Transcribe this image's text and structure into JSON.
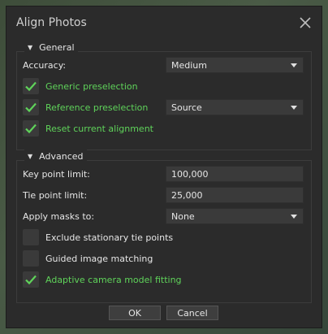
{
  "dialog": {
    "title": "Align Photos"
  },
  "general": {
    "header": "General",
    "accuracy_label": "Accuracy:",
    "accuracy_value": "Medium",
    "generic_preselection": {
      "label": "Generic preselection",
      "checked": true
    },
    "reference_preselection": {
      "label": "Reference preselection",
      "checked": true,
      "value": "Source"
    },
    "reset_alignment": {
      "label": "Reset current alignment",
      "checked": true
    }
  },
  "advanced": {
    "header": "Advanced",
    "key_point_limit_label": "Key point limit:",
    "key_point_limit_value": "100,000",
    "tie_point_limit_label": "Tie point limit:",
    "tie_point_limit_value": "25,000",
    "apply_masks_label": "Apply masks to:",
    "apply_masks_value": "None",
    "exclude_stationary": {
      "label": "Exclude stationary tie points",
      "checked": false
    },
    "guided_matching": {
      "label": "Guided image matching",
      "checked": false
    },
    "adaptive_fitting": {
      "label": "Adaptive camera model fitting",
      "checked": true
    }
  },
  "buttons": {
    "ok": "OK",
    "cancel": "Cancel"
  },
  "colors": {
    "checked_text": "#5fd35a",
    "dialog_bg": "#2b2b2b",
    "control_bg": "#3a3a3a"
  }
}
